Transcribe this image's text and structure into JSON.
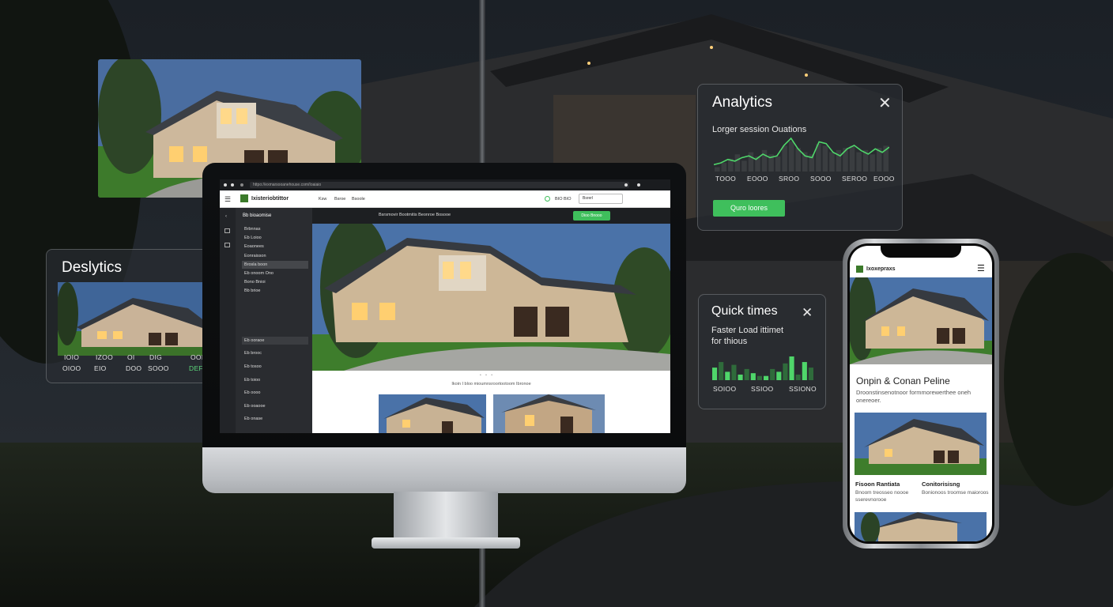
{
  "colors": {
    "accent": "#3fbf5c",
    "panel": "rgba(40,44,50,0.72)"
  },
  "analytics": {
    "title": "Analytics",
    "subtitle": "Lorger session Ouations",
    "axis": [
      "TOOO",
      "EOOO",
      "SROO",
      "SOOO",
      "SEROO",
      "EOOO"
    ],
    "button": "Quro loores",
    "line_values": [
      3,
      4,
      6,
      5,
      7,
      8,
      6,
      9,
      7,
      8,
      14,
      18,
      12,
      8,
      7,
      16,
      15,
      10,
      8,
      12,
      14,
      11,
      9,
      12,
      10,
      13
    ],
    "bar_values": [
      2,
      4,
      6,
      8,
      5,
      9,
      7,
      10,
      8,
      7,
      12,
      14,
      11,
      9,
      8,
      13,
      12,
      9,
      10,
      11,
      12,
      9,
      10,
      8,
      11,
      12
    ]
  },
  "deslytics": {
    "title": "Deslytics",
    "row1": [
      "IOIO",
      "IZOO",
      "OI",
      "DIG",
      "OOEM"
    ],
    "row2": [
      "OIOO",
      "EIO",
      "DOO",
      "SOOO",
      "DEFFINE"
    ]
  },
  "quick": {
    "title": "Quick times",
    "subtitle": "Faster Load ittimet for thious",
    "axis": [
      "SOIOO",
      "SSIOO",
      "SSIONO"
    ],
    "bar_values": [
      9,
      13,
      6,
      11,
      4,
      8,
      5,
      3,
      3,
      8,
      6,
      12,
      17,
      4,
      13,
      9
    ]
  },
  "monitor": {
    "url": "httpo://exmarsooanehouse.com/Ioaiaio",
    "brand": "Ixisteriobtittor",
    "nav": [
      "Ksw",
      "Bsroe",
      "Bsoole"
    ],
    "nav_right": "BIO BIO",
    "nav_btn": "Bsrerl",
    "sub_links": "Bsrsmovir Bootmitis Beonroe Bosooe",
    "cta": "Dioo Bnooo",
    "side_head": "Bb bioaomise",
    "side_items": [
      "Brbnnas",
      "Eb Loioo",
      "Eoaonees",
      "Eonraisson",
      "Brosla boon",
      "Eb onoom Ono",
      "Bono Bnioi",
      "Bb brioe",
      "Eb ooraoe",
      "Eb brooc",
      "Eb tosoo",
      "Eb toioo",
      "Eb oooo",
      "Eb ooaooe",
      "Eb onase"
    ],
    "caption": "Ikoin I bloo mioumnsroortootoom Ibronoe"
  },
  "phone": {
    "brand": "Ixoxepraxs",
    "heading": "Onpin & Conan Peline",
    "desc": "Droonstinsenotnoor formmorewerthee oneh onereoer.",
    "col1_title": "Fisoon Rantiata",
    "col1_desc": "Bnoom treosseo noooe sserevnorooe",
    "col2_title": "Conitorisisng",
    "col2_desc": "Bonionoos troomse maioroos"
  }
}
